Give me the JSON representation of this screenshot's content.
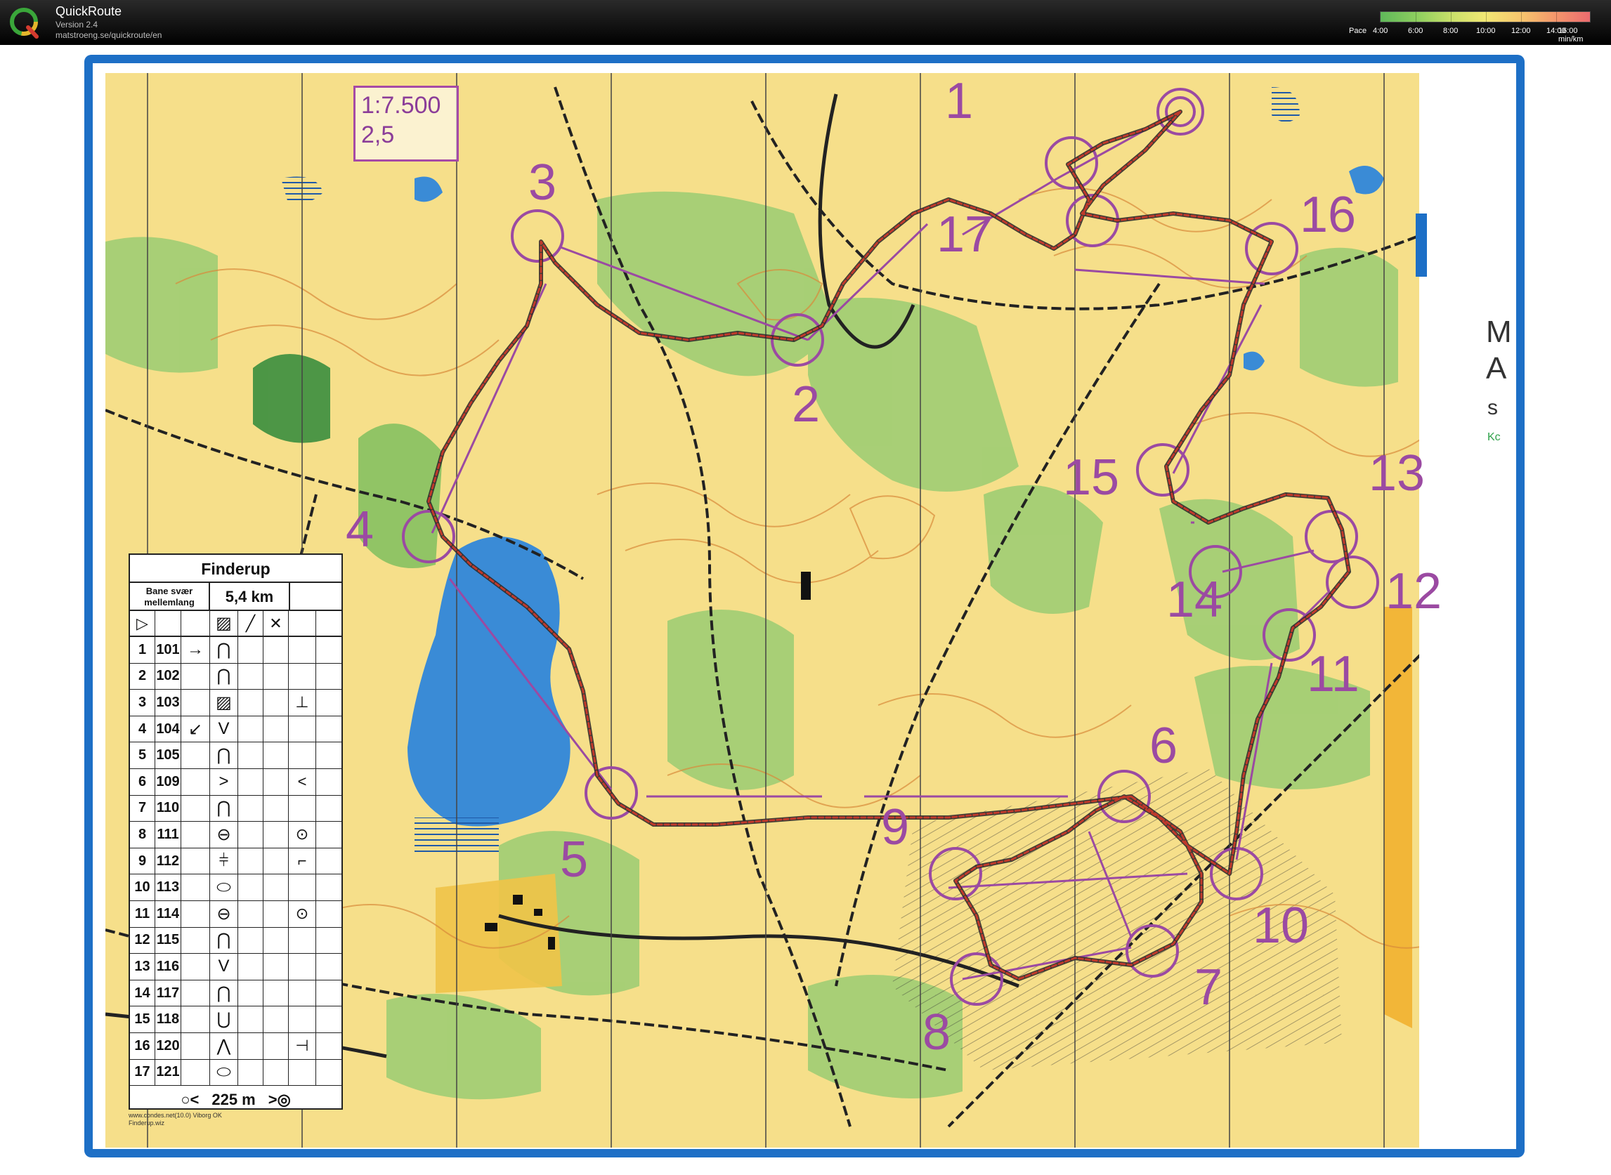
{
  "header": {
    "app_title": "QuickRoute",
    "version": "Version 2.4",
    "url": "matstroeng.se/quickroute/en",
    "pace_label": "Pace",
    "pace_ticks": [
      "4:00",
      "6:00",
      "8:00",
      "10:00",
      "12:00",
      "14:00",
      "16:00"
    ],
    "pace_unit": "min/km"
  },
  "map": {
    "scale": "1:7.500",
    "contour": "2,5",
    "controls": [
      "1",
      "2",
      "3",
      "4",
      "5",
      "6",
      "7",
      "8",
      "9",
      "10",
      "11",
      "12",
      "13",
      "14",
      "15",
      "16",
      "17"
    ],
    "side_letters": [
      "M",
      "A",
      "s",
      "Kc"
    ]
  },
  "description": {
    "title": "Finderup",
    "course_line1": "Bane svær",
    "course_line2": "mellemlang",
    "length": "5,4 km",
    "rows": [
      {
        "n": "1",
        "code": "101",
        "dir": "→",
        "feature": "⋂",
        "extra": ""
      },
      {
        "n": "2",
        "code": "102",
        "dir": "",
        "feature": "⋂",
        "extra": ""
      },
      {
        "n": "3",
        "code": "103",
        "dir": "",
        "feature": "▨",
        "extra": "⊥"
      },
      {
        "n": "4",
        "code": "104",
        "dir": "↙",
        "feature": "V",
        "extra": ""
      },
      {
        "n": "5",
        "code": "105",
        "dir": "",
        "feature": "⋂",
        "extra": ""
      },
      {
        "n": "6",
        "code": "109",
        "dir": "",
        "feature": ">",
        "extra": "<"
      },
      {
        "n": "7",
        "code": "110",
        "dir": "",
        "feature": "⋂",
        "extra": ""
      },
      {
        "n": "8",
        "code": "111",
        "dir": "",
        "feature": "⊖",
        "extra": "⊙"
      },
      {
        "n": "9",
        "code": "112",
        "dir": "",
        "feature": "⫩",
        "extra": "⌐"
      },
      {
        "n": "10",
        "code": "113",
        "dir": "",
        "feature": "⬭",
        "extra": ""
      },
      {
        "n": "11",
        "code": "114",
        "dir": "",
        "feature": "⊖",
        "extra": "⊙"
      },
      {
        "n": "12",
        "code": "115",
        "dir": "",
        "feature": "⋂",
        "extra": ""
      },
      {
        "n": "13",
        "code": "116",
        "dir": "",
        "feature": "V",
        "extra": ""
      },
      {
        "n": "14",
        "code": "117",
        "dir": "",
        "feature": "⋂",
        "extra": ""
      },
      {
        "n": "15",
        "code": "118",
        "dir": "",
        "feature": "⋃",
        "extra": ""
      },
      {
        "n": "16",
        "code": "120",
        "dir": "",
        "feature": "⋀",
        "extra": "⊣"
      },
      {
        "n": "17",
        "code": "121",
        "dir": "",
        "feature": "⬭",
        "extra": ""
      }
    ],
    "footer_distance": "225 m",
    "credit_line1": "www.condes.net(10.0) Viborg OK",
    "credit_line2": "Finderup.wiz"
  },
  "colors": {
    "course": "#9b4aa2",
    "route": "#c0392b",
    "water": "#3a8bd6",
    "open_land": "#f6df8a",
    "forest_green": "#8cc56a",
    "frame_blue": "#1d6fc6"
  }
}
